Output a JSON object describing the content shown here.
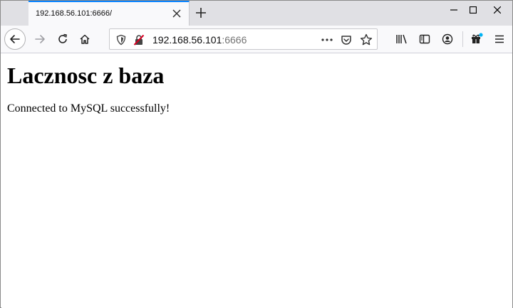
{
  "tab": {
    "title": "192.168.56.101:6666/"
  },
  "url": {
    "host": "192.168.56.101",
    "port": ":6666"
  },
  "page": {
    "heading": "Lacznosc z baza",
    "message": "Connected to MySQL successfully!"
  },
  "icons": {
    "tab_close": "close-icon",
    "new_tab": "plus-icon",
    "back": "arrow-left-icon",
    "forward": "arrow-right-icon",
    "reload": "reload-icon",
    "home": "home-icon",
    "tracking": "shield-icon",
    "insecure": "insecure-lock-icon",
    "page_actions": "more-dots-icon",
    "pocket": "pocket-icon",
    "bookmark": "star-icon",
    "library": "library-icon",
    "sidebar": "sidebar-icon",
    "account": "account-icon",
    "extensions": "extensions-icon",
    "menu": "hamburger-menu-icon"
  },
  "colors": {
    "accent": "#0a84ff",
    "insecure": "#d70022",
    "badge": "#00b3f4"
  }
}
